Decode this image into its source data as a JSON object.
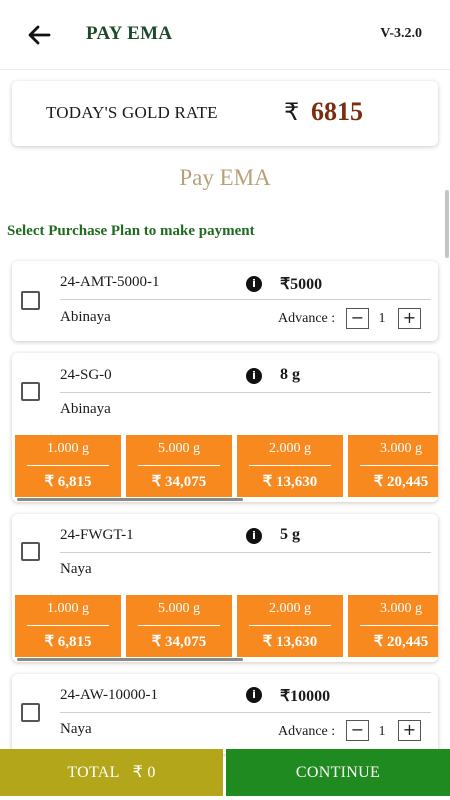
{
  "header": {
    "title": "PAY EMA",
    "version": "V-3.2.0"
  },
  "gold_rate": {
    "label": "TODAY'S GOLD RATE",
    "currency_symbol": "₹",
    "value": "6815"
  },
  "page_heading": "Pay EMA",
  "instruction": "Select Purchase Plan to make payment",
  "plans": [
    {
      "code": "24-AMT-5000-1",
      "amount": "₹5000",
      "name": "Abinaya",
      "advance_label": "Advance :",
      "advance_value": "1",
      "minus": "−",
      "plus": "+"
    },
    {
      "code": "24-SG-0",
      "amount": "8 g",
      "name": "Abinaya",
      "options": [
        {
          "weight": "1.000 g",
          "price": "₹ 6,815"
        },
        {
          "weight": "5.000 g",
          "price": "₹ 34,075"
        },
        {
          "weight": "2.000 g",
          "price": "₹ 13,630"
        },
        {
          "weight": "3.000 g",
          "price": "₹ 20,445"
        }
      ]
    },
    {
      "code": "24-FWGT-1",
      "amount": "5 g",
      "name": "Naya",
      "options": [
        {
          "weight": "1.000 g",
          "price": "₹ 6,815"
        },
        {
          "weight": "5.000 g",
          "price": "₹ 34,075"
        },
        {
          "weight": "2.000 g",
          "price": "₹ 13,630"
        },
        {
          "weight": "3.000 g",
          "price": "₹ 20,445"
        }
      ]
    },
    {
      "code": "24-AW-10000-1",
      "amount": "₹10000",
      "name": "Naya",
      "advance_label": "Advance :",
      "advance_value": "1",
      "minus": "−",
      "plus": "+"
    }
  ],
  "footer": {
    "total_label": "TOTAL",
    "total_value": "₹ 0",
    "continue_label": "CONTINUE"
  },
  "icons": {
    "back": "arrow-left-icon",
    "info": "info-icon",
    "checkbox": "checkbox-icon"
  },
  "colors": {
    "accent_orange": "#f7891f",
    "continue_green": "#1f8a1f",
    "total_olive": "#b3a61a",
    "rate_brown": "#7a2e0e",
    "heading_tan": "#b8a07a",
    "instruction_green": "#1f6b1f"
  }
}
